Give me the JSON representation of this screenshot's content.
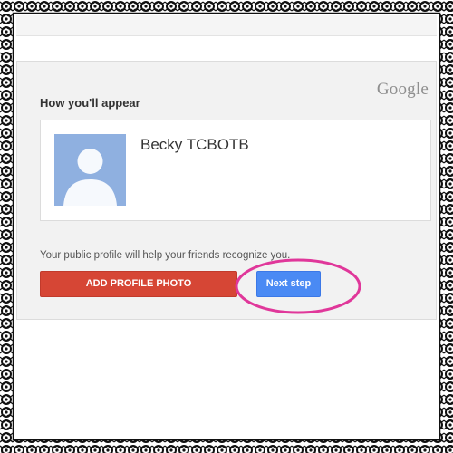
{
  "page": {
    "google_logo": "Google",
    "heading": "How you'll appear",
    "profile_name": "Becky TCBOTB",
    "helper_text": "Your public profile will help your friends recognize you.",
    "add_photo_button": "ADD PROFILE PHOTO",
    "next_step_button": "Next step"
  },
  "icons": {
    "avatar": "default-person-silhouette-icon",
    "frame": "lace-border"
  },
  "colors": {
    "add_photo_button": "#d64635",
    "next_step_button": "#4a8af4",
    "avatar_bg": "#8fb0e0",
    "highlight_ellipse": "#e0379a"
  }
}
